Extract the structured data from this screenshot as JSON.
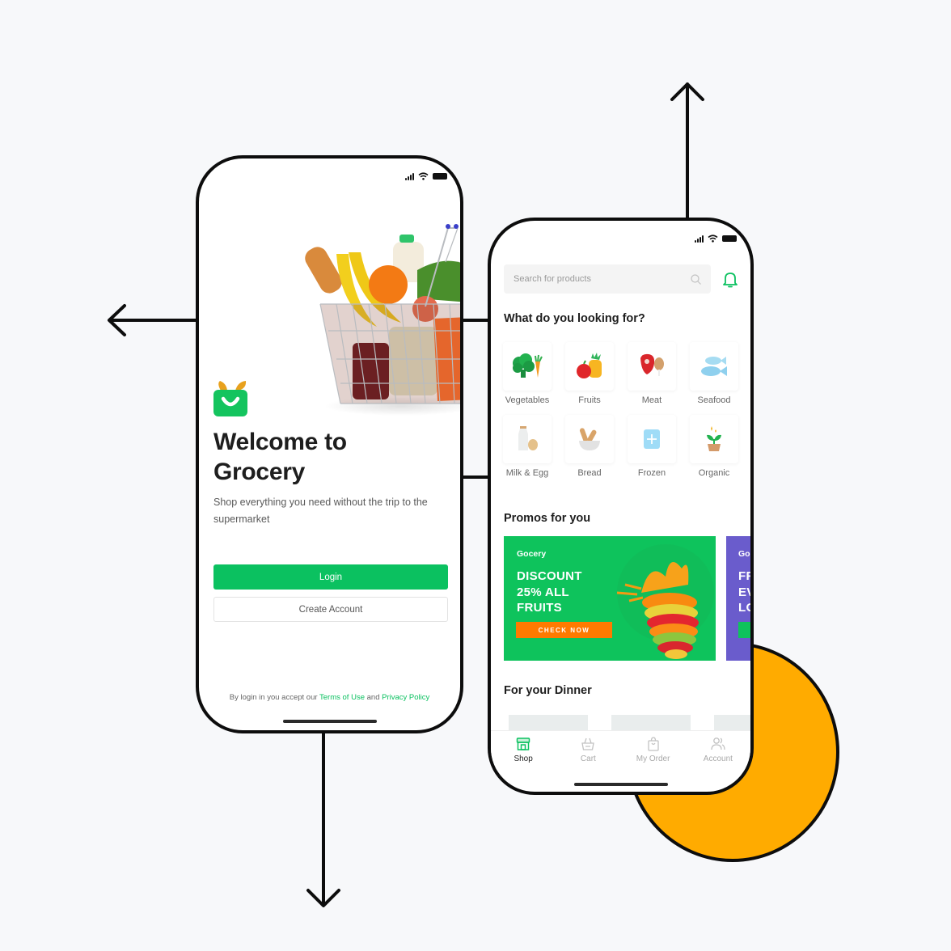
{
  "colors": {
    "background": "#f7f8fa",
    "accent_green": "#0bc160",
    "accent_orange": "#ff7a00",
    "promo_purple": "#6a5ccc",
    "decor_yellow": "#ffab00"
  },
  "welcome_screen": {
    "status_icons": [
      "signal-icon",
      "wifi-icon",
      "battery-icon"
    ],
    "hero_image": "grocery-basket",
    "logo": "grocery-bag-logo",
    "title_line1": "Welcome to",
    "title_line2": "Grocery",
    "subtitle": "Shop everything you need without the trip to the supermarket",
    "login_label": "Login",
    "create_account_label": "Create Account",
    "terms": {
      "prefix": "By login in you accept our",
      "terms_link": "Terms of Use",
      "conjunction": "and",
      "privacy_link": "Privacy Policy"
    }
  },
  "shop_screen": {
    "status_icons": [
      "signal-icon",
      "wifi-icon",
      "battery-icon"
    ],
    "search": {
      "placeholder": "Search for products",
      "value": ""
    },
    "categories_title": "What do you looking for?",
    "categories": [
      {
        "label": "Vegetables",
        "icon": "broccoli-carrot-icon"
      },
      {
        "label": "Fruits",
        "icon": "apple-pineapple-icon"
      },
      {
        "label": "Meat",
        "icon": "steak-drumstick-icon"
      },
      {
        "label": "Seafood",
        "icon": "fish-icon"
      },
      {
        "label": "Milk & Egg",
        "icon": "milk-egg-icon"
      },
      {
        "label": "Bread",
        "icon": "bread-bowl-icon"
      },
      {
        "label": "Frozen",
        "icon": "ice-cube-icon"
      },
      {
        "label": "Organic",
        "icon": "sprout-icon"
      }
    ],
    "promos_title": "Promos for you",
    "promos": [
      {
        "brand": "Gocery",
        "headline": [
          "DISCOUNT",
          "25% ALL",
          "FRUITS"
        ],
        "cta": "CHECK NOW"
      },
      {
        "brand": "Go",
        "headline": [
          "FR",
          "EV",
          "LO"
        ],
        "cta": ""
      }
    ],
    "dinner_title": "For your Dinner",
    "tabs": [
      {
        "label": "Shop",
        "icon": "store-icon",
        "active": true
      },
      {
        "label": "Cart",
        "icon": "basket-icon",
        "active": false
      },
      {
        "label": "My Order",
        "icon": "shopping-bag-icon",
        "active": false
      },
      {
        "label": "Account",
        "icon": "users-icon",
        "active": false
      }
    ]
  }
}
